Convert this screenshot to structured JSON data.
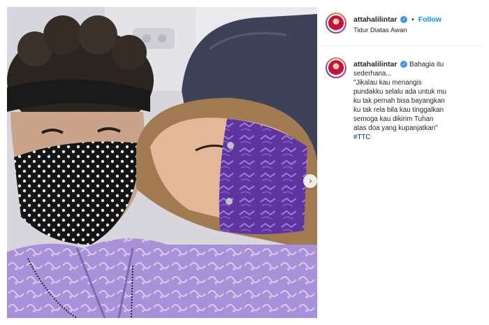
{
  "post": {
    "username": "attahalilintar",
    "follow_label": "Follow",
    "separator": "•",
    "location": "Tidur Diatas Awan",
    "caption_lines": [
      "Bahagia itu",
      "sederhana...",
      "\"Jikalau kau menangis",
      "pundakku selalu ada untuk mu",
      "ku tak pernah bisa bayangkan",
      "ku tak rela bila kau tinggalkan",
      "semoga kau dikirim Tuhan",
      "atas doa yang kupanjatkan\""
    ],
    "hashtag": "#TTC"
  },
  "icons": {
    "verified": "verified-badge-icon",
    "next": "chevron-right-icon"
  },
  "colors": {
    "link_blue": "#0095f6",
    "verified_blue": "#3897f0",
    "hashtag": "#00376b",
    "mask_purple": "#6a3fa8",
    "shirt_lilac": "#a992d6"
  }
}
